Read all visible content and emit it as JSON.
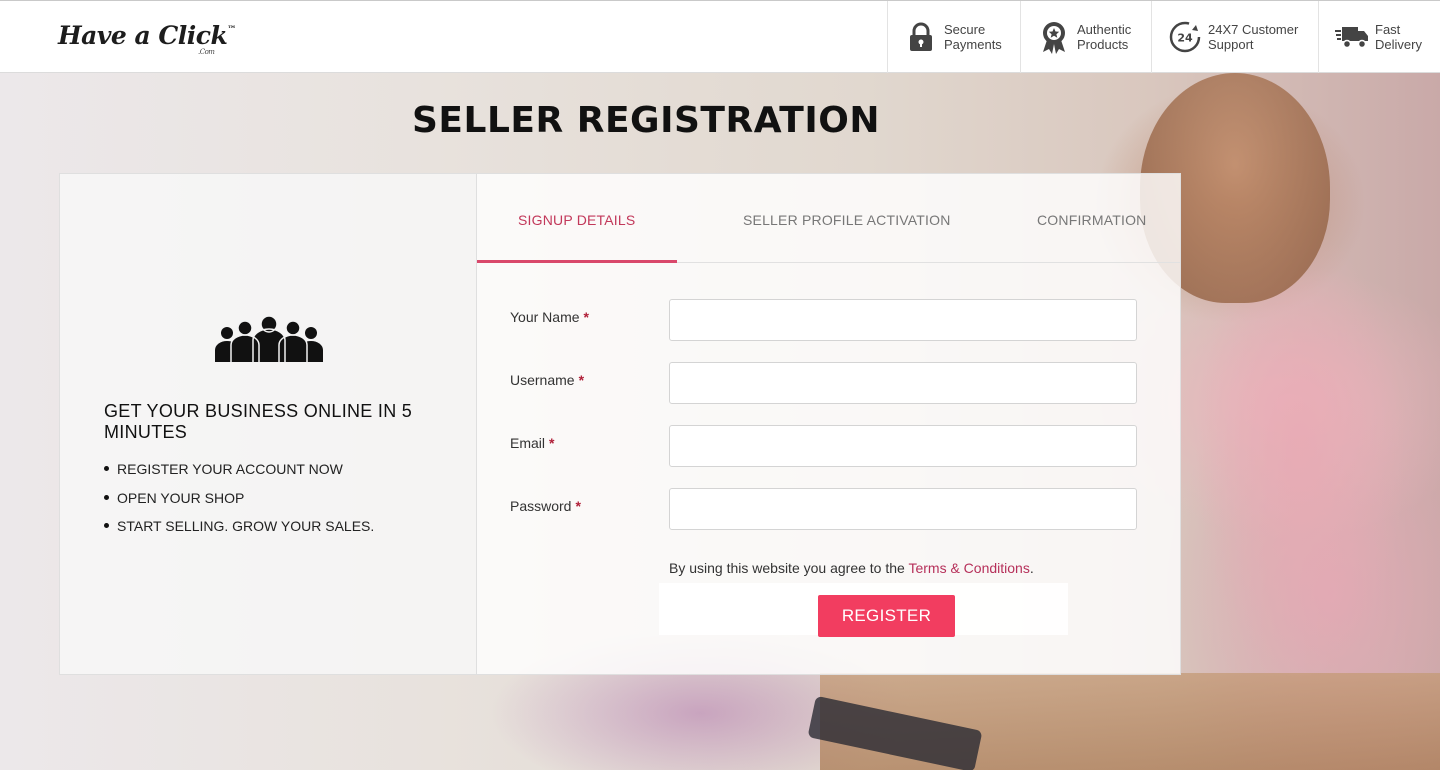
{
  "header": {
    "logo_text": "Have a Click",
    "logo_tm": "™",
    "logo_sub": ".Com",
    "features": [
      {
        "icon": "lock-icon",
        "line1": "Secure",
        "line2": "Payments"
      },
      {
        "icon": "award-badge-icon",
        "line1": "Authentic",
        "line2": "Products"
      },
      {
        "icon": "24-hour-support-icon",
        "line1": "24X7 Customer",
        "line2": "Support"
      },
      {
        "icon": "delivery-truck-icon",
        "line1": "Fast",
        "line2": "Delivery"
      }
    ]
  },
  "page_title": "SELLER REGISTRATION",
  "promo": {
    "icon": "group-people-icon",
    "title": "GET YOUR BUSINESS ONLINE IN 5 MINUTES",
    "items": [
      "REGISTER YOUR ACCOUNT NOW",
      "OPEN YOUR SHOP",
      "START SELLING. GROW YOUR SALES."
    ]
  },
  "tabs": [
    {
      "label": "SIGNUP DETAILS",
      "active": true
    },
    {
      "label": "SELLER PROFILE ACTIVATION",
      "active": false
    },
    {
      "label": "CONFIRMATION",
      "active": false
    }
  ],
  "form": {
    "fields": [
      {
        "label": "Your Name",
        "required": "*",
        "value": "",
        "placeholder": ""
      },
      {
        "label": "Username",
        "required": "*",
        "value": "",
        "placeholder": ""
      },
      {
        "label": "Email",
        "required": "*",
        "value": "",
        "placeholder": ""
      },
      {
        "label": "Password",
        "required": "*",
        "value": "",
        "placeholder": ""
      }
    ],
    "terms_prefix": "By using this website you agree to the ",
    "terms_link": "Terms & Conditions",
    "terms_suffix": ".",
    "register_label": "REGISTER"
  },
  "colors": {
    "accent": "#f23d60",
    "active_tab": "#c2385a",
    "link": "#b6305a"
  }
}
